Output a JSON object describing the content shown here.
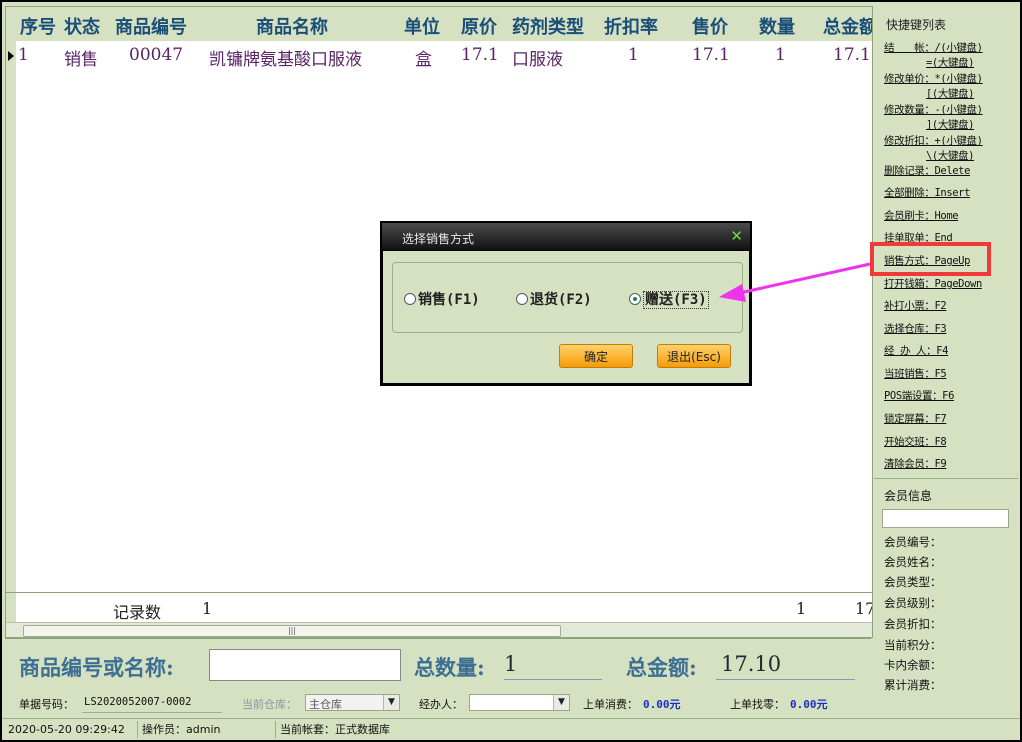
{
  "grid": {
    "columns": [
      "序号",
      "状态",
      "商品编号",
      "商品名称",
      "单位",
      "原价",
      "药剂类型",
      "折扣率",
      "售价",
      "数量",
      "总金额"
    ],
    "rows": [
      {
        "seq": "1",
        "status": "销售",
        "code": "00047",
        "name": "凯镛牌氨基酸口服液",
        "unit": "盒",
        "orig_price": "17.1",
        "type": "口服液",
        "discount": "1",
        "price": "17.1",
        "qty": "1",
        "total": "17.1"
      }
    ],
    "footer": {
      "label": "记录数",
      "count": "1",
      "qty_sum": "1",
      "total_sum": "17"
    }
  },
  "shortcuts": {
    "title": "快捷键列表",
    "items": [
      {
        "label": "结　　帐：/(小键盘)"
      },
      {
        "label": "=(大键盘)"
      },
      {
        "label": "修改单价：*(小键盘)"
      },
      {
        "label": "[(大键盘)"
      },
      {
        "label": "修改数量：-(小键盘)"
      },
      {
        "label": "](大键盘)"
      },
      {
        "label": "修改折扣：+(小键盘)"
      },
      {
        "label": "\\(大键盘)"
      },
      {
        "label": "删除记录：Delete"
      },
      {
        "label": "全部删除：Insert"
      },
      {
        "label": "会员刷卡：Home"
      },
      {
        "label": "挂单取单：End"
      },
      {
        "label": "销售方式：PageUp"
      },
      {
        "label": "打开钱箱：PageDown"
      },
      {
        "label": "补打小票：F2"
      },
      {
        "label": "选择仓库：F3"
      },
      {
        "label": "经 办 人：F4"
      },
      {
        "label": "当班销售：F5"
      },
      {
        "label": "POS端设置：F6"
      },
      {
        "label": "锁定屏幕：F7"
      },
      {
        "label": "开始交班：F8"
      },
      {
        "label": "清除会员：F9"
      }
    ]
  },
  "member": {
    "title": "会员信息",
    "fields": [
      "会员编号：",
      "会员姓名：",
      "会员类型：",
      "会员级别：",
      "会员折扣：",
      "当前积分：",
      "卡内余额：",
      "累计消费："
    ]
  },
  "bottom": {
    "code_label": "商品编号或名称:",
    "qty_label": "总数量:",
    "qty_value": "1",
    "amount_label": "总金额:",
    "amount_value": "17.10",
    "order_label": "单据号码：",
    "order_value": "LS2020052007-0002",
    "warehouse_label": "当前仓库：",
    "warehouse_value": "主仓库",
    "handler_label": "经办人：",
    "last_spend_label": "上单消费：",
    "last_spend_value": "0.00元",
    "last_change_label": "上单找零：",
    "last_change_value": "0.00元"
  },
  "statusbar": {
    "datetime": "2020-05-20 09:29:42",
    "operator": "操作员：admin",
    "account": "当前帐套：正式数据库"
  },
  "dialog": {
    "title": "选择销售方式",
    "options": [
      {
        "label": "销售(F1)",
        "selected": false
      },
      {
        "label": "退货(F2)",
        "selected": false
      },
      {
        "label": "赠送(F3)",
        "selected": true
      }
    ],
    "ok_label": "确定",
    "cancel_label": "退出(Esc)"
  },
  "colors": {
    "panel_bg": "#d6e1c2",
    "header_text": "#1a4f78",
    "highlight": "#f03a3a",
    "arrow": "#ee33ee",
    "money": "#1b2fc7"
  }
}
